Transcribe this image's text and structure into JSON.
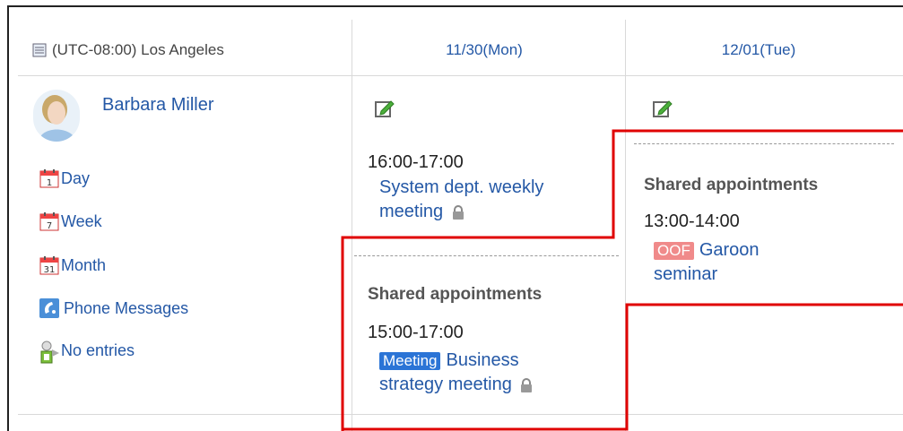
{
  "header": {
    "timezone": "(UTC-08:00) Los Angeles",
    "days": [
      "11/30(Mon)",
      "12/01(Tue)"
    ]
  },
  "user": {
    "name": "Barbara Miller",
    "menu": {
      "day": "Day",
      "week": "Week",
      "month": "Month",
      "phone": "Phone Messages",
      "no_entries": "No entries"
    },
    "calendar_icons": {
      "day": "1",
      "week": "7",
      "month": "31"
    }
  },
  "day1": {
    "event1": {
      "time": "16:00-17:00",
      "title_line1": "System dept. weekly",
      "title_line2": "meeting"
    },
    "shared_label": "Shared appointments",
    "event2": {
      "time": "15:00-17:00",
      "badge": "Meeting",
      "title_line1": "Business",
      "title_line2": "strategy meeting"
    }
  },
  "day2": {
    "shared_label": "Shared appointments",
    "event1": {
      "time": "13:00-14:00",
      "badge": "OOF",
      "title_line1": "Garoon",
      "title_line2": "seminar"
    }
  },
  "colors": {
    "link": "#2458a6",
    "highlight": "#e00000",
    "meeting_badge": "#2b74d6",
    "oof_badge": "#f08a8a"
  }
}
